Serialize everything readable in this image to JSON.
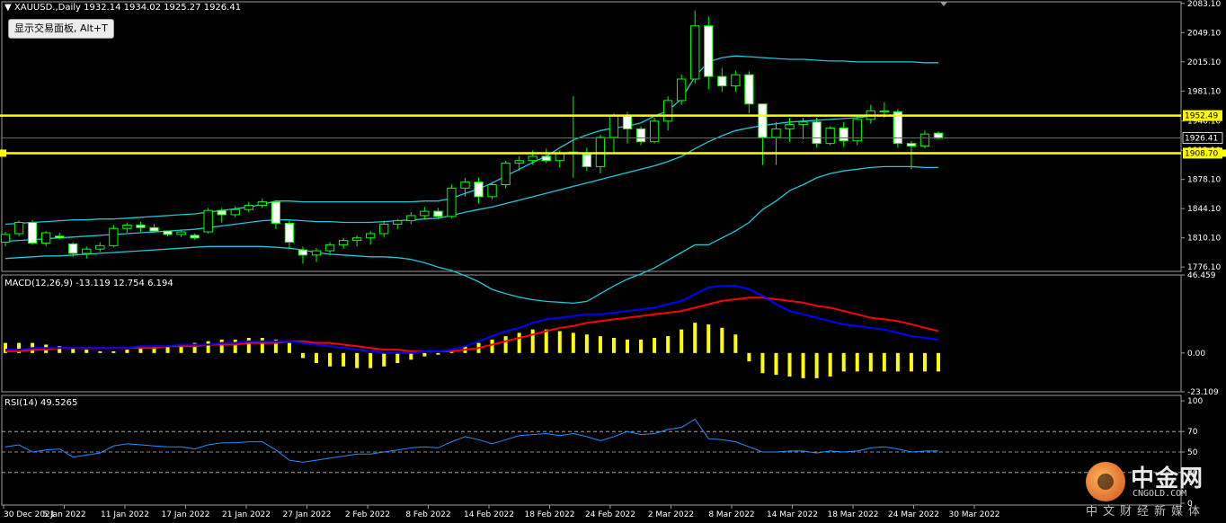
{
  "window": {
    "symbol_header": "XAUUSD.,Daily  1932.14 1934.02 1925.27 1926.41",
    "trade_panel_button": "显示交易面板, Alt+T"
  },
  "colors": {
    "background": "#000000",
    "bull": "#00ff00",
    "bear": "#ffffff",
    "bollinger": "#1fc8d8",
    "levels": "#ffff00",
    "macd_main": "#0000ff",
    "macd_signal": "#ff0000",
    "macd_hist": "#ffff00",
    "rsi": "#1e90ff",
    "axis_text": "#ffffff",
    "grid": "#2a2a2a"
  },
  "chart_data": [
    {
      "type": "candlestick",
      "title": "XAUUSD.,Daily  1932.14 1934.02 1925.27 1926.41",
      "x_labels": [
        "30 Dec 2021",
        "5 Jan 2022",
        "11 Jan 2022",
        "17 Jan 2022",
        "21 Jan 2022",
        "27 Jan 2022",
        "2 Feb 2022",
        "8 Feb 2022",
        "14 Feb 2022",
        "18 Feb 2022",
        "24 Feb 2022",
        "2 Mar 2022",
        "8 Mar 2022",
        "14 Mar 2022",
        "18 Mar 2022",
        "24 Mar 2022",
        "30 Mar 2022"
      ],
      "y_ticks": [
        1776.1,
        1810.1,
        1844.1,
        1878.1,
        1912.1,
        1946.1,
        1981.1,
        2015.1,
        2049.1,
        2083.1
      ],
      "ylim": [
        1771,
        2085
      ],
      "candles": [
        [
          1805,
          1817,
          1800,
          1814
        ],
        [
          1815,
          1830,
          1812,
          1828
        ],
        [
          1828,
          1831,
          1802,
          1804
        ],
        [
          1804,
          1818,
          1800,
          1816
        ],
        [
          1812,
          1816,
          1808,
          1810
        ],
        [
          1803,
          1805,
          1788,
          1792
        ],
        [
          1792,
          1800,
          1786,
          1797
        ],
        [
          1797,
          1805,
          1794,
          1801
        ],
        [
          1801,
          1825,
          1799,
          1821
        ],
        [
          1821,
          1828,
          1816,
          1825
        ],
        [
          1825,
          1829,
          1817,
          1822
        ],
        [
          1822,
          1826,
          1816,
          1818
        ],
        [
          1818,
          1818,
          1812,
          1814
        ],
        [
          1814,
          1820,
          1811,
          1817
        ],
        [
          1813,
          1815,
          1808,
          1810
        ],
        [
          1817,
          1845,
          1815,
          1842
        ],
        [
          1842,
          1845,
          1828,
          1837
        ],
        [
          1837,
          1847,
          1834,
          1843
        ],
        [
          1843,
          1852,
          1840,
          1848
        ],
        [
          1848,
          1856,
          1845,
          1852
        ],
        [
          1852,
          1854,
          1820,
          1827
        ],
        [
          1827,
          1830,
          1797,
          1805
        ],
        [
          1796,
          1800,
          1780,
          1790
        ],
        [
          1790,
          1798,
          1782,
          1795
        ],
        [
          1795,
          1805,
          1790,
          1802
        ],
        [
          1802,
          1810,
          1797,
          1807
        ],
        [
          1807,
          1813,
          1800,
          1810
        ],
        [
          1810,
          1818,
          1802,
          1815
        ],
        [
          1815,
          1830,
          1811,
          1826
        ],
        [
          1826,
          1832,
          1820,
          1830
        ],
        [
          1830,
          1840,
          1826,
          1836
        ],
        [
          1836,
          1846,
          1832,
          1841
        ],
        [
          1841,
          1845,
          1832,
          1835
        ],
        [
          1835,
          1872,
          1833,
          1868
        ],
        [
          1868,
          1880,
          1858,
          1875
        ],
        [
          1875,
          1880,
          1850,
          1858
        ],
        [
          1858,
          1875,
          1855,
          1872
        ],
        [
          1872,
          1900,
          1868,
          1897
        ],
        [
          1897,
          1905,
          1888,
          1900
        ],
        [
          1900,
          1912,
          1895,
          1905
        ],
        [
          1905,
          1914,
          1897,
          1900
        ],
        [
          1900,
          1912,
          1892,
          1908
        ],
        [
          1908,
          1975,
          1880,
          1910
        ],
        [
          1907,
          1915,
          1888,
          1893
        ],
        [
          1893,
          1930,
          1885,
          1927
        ],
        [
          1927,
          1955,
          1910,
          1953
        ],
        [
          1952,
          1957,
          1920,
          1937
        ],
        [
          1937,
          1940,
          1918,
          1922
        ],
        [
          1922,
          1950,
          1920,
          1946
        ],
        [
          1946,
          1975,
          1935,
          1970
        ],
        [
          1970,
          2000,
          1965,
          1995
        ],
        [
          1995,
          2075,
          1990,
          2057
        ],
        [
          2057,
          2068,
          1983,
          1998
        ],
        [
          1998,
          2008,
          1980,
          1987
        ],
        [
          1987,
          2005,
          1980,
          2000
        ],
        [
          2000,
          2004,
          1955,
          1966
        ],
        [
          1966,
          1960,
          1895,
          1927
        ],
        [
          1927,
          1945,
          1895,
          1937
        ],
        [
          1937,
          1950,
          1922,
          1942
        ],
        [
          1942,
          1950,
          1925,
          1945
        ],
        [
          1945,
          1950,
          1915,
          1920
        ],
        [
          1920,
          1940,
          1918,
          1938
        ],
        [
          1938,
          1945,
          1916,
          1923
        ],
        [
          1923,
          1952,
          1918,
          1948
        ],
        [
          1948,
          1965,
          1943,
          1958
        ],
        [
          1958,
          1968,
          1950,
          1957
        ],
        [
          1957,
          1960,
          1915,
          1920
        ],
        [
          1920,
          1923,
          1890,
          1917
        ],
        [
          1917,
          1935,
          1914,
          1931
        ],
        [
          1932,
          1934,
          1925,
          1926
        ]
      ],
      "bollinger_upper": [
        1826,
        1827,
        1828,
        1829,
        1830,
        1831,
        1831,
        1832,
        1832,
        1833,
        1834,
        1835,
        1836,
        1837,
        1838,
        1840,
        1842,
        1844,
        1846,
        1849,
        1853,
        1853,
        1852,
        1852,
        1852,
        1852,
        1852,
        1852,
        1852,
        1852,
        1852,
        1853,
        1853,
        1856,
        1862,
        1867,
        1874,
        1882,
        1890,
        1898,
        1905,
        1915,
        1924,
        1930,
        1935,
        1938,
        1940,
        1944,
        1952,
        1958,
        1972,
        1998,
        2015,
        2020,
        2022,
        2021,
        2020,
        2019,
        2018,
        2018,
        2017,
        2016,
        2016,
        2015,
        2015,
        2015,
        2015,
        2015,
        2014,
        2014
      ],
      "bollinger_middle": [
        1806,
        1807,
        1808,
        1809,
        1810,
        1811,
        1812,
        1813,
        1814,
        1815,
        1816,
        1817,
        1818,
        1819,
        1820,
        1822,
        1824,
        1826,
        1828,
        1830,
        1831,
        1831,
        1830,
        1829,
        1829,
        1828,
        1828,
        1828,
        1829,
        1830,
        1831,
        1832,
        1833,
        1836,
        1840,
        1843,
        1846,
        1850,
        1854,
        1858,
        1862,
        1866,
        1870,
        1874,
        1878,
        1882,
        1886,
        1890,
        1894,
        1899,
        1905,
        1914,
        1922,
        1929,
        1935,
        1938,
        1941,
        1943,
        1945,
        1946,
        1947,
        1948,
        1949,
        1950,
        1952,
        1953,
        1953,
        1953,
        1953,
        1953
      ],
      "bollinger_lower": [
        1786,
        1787,
        1788,
        1789,
        1789,
        1790,
        1791,
        1792,
        1793,
        1794,
        1795,
        1796,
        1797,
        1798,
        1799,
        1800,
        1800,
        1800,
        1800,
        1800,
        1799,
        1798,
        1796,
        1793,
        1791,
        1790,
        1789,
        1788,
        1788,
        1787,
        1785,
        1781,
        1776,
        1772,
        1766,
        1759,
        1750,
        1745,
        1741,
        1738,
        1736,
        1735,
        1734,
        1736,
        1745,
        1754,
        1762,
        1768,
        1775,
        1784,
        1793,
        1802,
        1802,
        1810,
        1818,
        1828,
        1843,
        1853,
        1865,
        1872,
        1880,
        1885,
        1888,
        1890,
        1892,
        1893,
        1893,
        1893,
        1892,
        1892
      ],
      "horizontal_levels": [
        1952.49,
        1908.7
      ],
      "level_labels": [
        "1952.49",
        "1908.70"
      ],
      "current_price": 1926.41,
      "current_price_label": "1926.41"
    },
    {
      "type": "bar",
      "title": "MACD(12,26,9) -13.119 12.754 6.194",
      "y_ticks_labels": [
        "46.459",
        "0.00",
        "-23.109"
      ],
      "y_ticks": [
        46.459,
        0.0,
        -23.109
      ],
      "ylim": [
        -23.109,
        46.459
      ],
      "histogram": [
        6,
        6,
        6,
        5,
        4,
        3,
        2,
        1,
        1,
        2,
        3,
        4,
        4,
        5,
        6,
        7,
        8,
        8,
        9,
        9,
        8,
        6,
        -3,
        -6,
        -8,
        -8,
        -9,
        -9,
        -8,
        -6,
        -4,
        -2,
        -1,
        1,
        4,
        6,
        8,
        10,
        12,
        14,
        14,
        13,
        12,
        11,
        10,
        9,
        8,
        8,
        9,
        10,
        14,
        18,
        17,
        15,
        11,
        -5,
        -12,
        -13,
        -14,
        -15,
        -15,
        -14,
        -11,
        -11,
        -11,
        -11,
        -11,
        -11,
        -11,
        -11
      ],
      "macd_main": [
        2,
        2,
        3,
        3,
        3,
        3,
        3,
        3,
        3,
        3,
        4,
        4,
        4,
        5,
        5,
        5,
        6,
        6,
        7,
        7,
        7,
        7,
        6,
        5,
        4,
        3,
        2,
        1,
        0,
        0,
        0,
        1,
        1,
        2,
        4,
        7,
        10,
        13,
        15,
        18,
        20,
        21,
        22,
        23,
        23,
        24,
        25,
        26,
        27,
        29,
        31,
        35,
        39,
        40,
        40,
        38,
        34,
        29,
        25,
        23,
        21,
        19,
        17,
        16,
        15,
        14,
        12,
        10,
        9,
        8
      ],
      "macd_signal": [
        1,
        1,
        2,
        2,
        3,
        3,
        3,
        3,
        3,
        3,
        3,
        3,
        4,
        4,
        4,
        5,
        5,
        5,
        6,
        6,
        6,
        7,
        7,
        6,
        6,
        5,
        4,
        3,
        2,
        2,
        1,
        1,
        1,
        1,
        2,
        3,
        5,
        7,
        9,
        11,
        13,
        15,
        16,
        18,
        19,
        20,
        21,
        22,
        23,
        24,
        25,
        27,
        29,
        31,
        32,
        33,
        33,
        32,
        31,
        30,
        28,
        27,
        25,
        23,
        21,
        20,
        19,
        17,
        15,
        13
      ]
    },
    {
      "type": "line",
      "title": "RSI(14) 49.5265",
      "y_ticks_labels": [
        "100",
        "70",
        "50",
        "30",
        "0"
      ],
      "y_ticks": [
        100,
        70,
        50,
        30,
        0
      ],
      "ylim": [
        0,
        100
      ],
      "reference_lines": [
        70,
        50,
        30
      ],
      "values": [
        55,
        57,
        50,
        52,
        53,
        45,
        47,
        49,
        56,
        58,
        57,
        56,
        55,
        55,
        53,
        57,
        59,
        59,
        60,
        60,
        52,
        42,
        40,
        42,
        44,
        46,
        48,
        48,
        50,
        52,
        54,
        55,
        54,
        60,
        65,
        62,
        58,
        62,
        66,
        67,
        68,
        66,
        68,
        65,
        61,
        65,
        70,
        67,
        68,
        72,
        74,
        82,
        63,
        62,
        60,
        55,
        50,
        50,
        51,
        51,
        49,
        51,
        50,
        51,
        54,
        55,
        53,
        50,
        51,
        51
      ]
    }
  ],
  "x_labels_display": [
    "30 Dec 2021",
    "5 Jan 2022",
    "11 Jan 2022",
    "17 Jan 2022",
    "21 Jan 2022",
    "27 Jan 2022",
    "2 Feb 2022",
    "8 Feb 2022",
    "14 Feb 2022",
    "18 Feb 2022",
    "24 Feb 2022",
    "2 Mar 2022",
    "8 Mar 2022",
    "14 Mar 2022",
    "18 Mar 2022",
    "24 Mar 2022",
    "30 Mar 2022"
  ],
  "watermark": {
    "cn": "中金网",
    "en": "CNGOLD.COM",
    "sub": "中文财经新媒体"
  }
}
